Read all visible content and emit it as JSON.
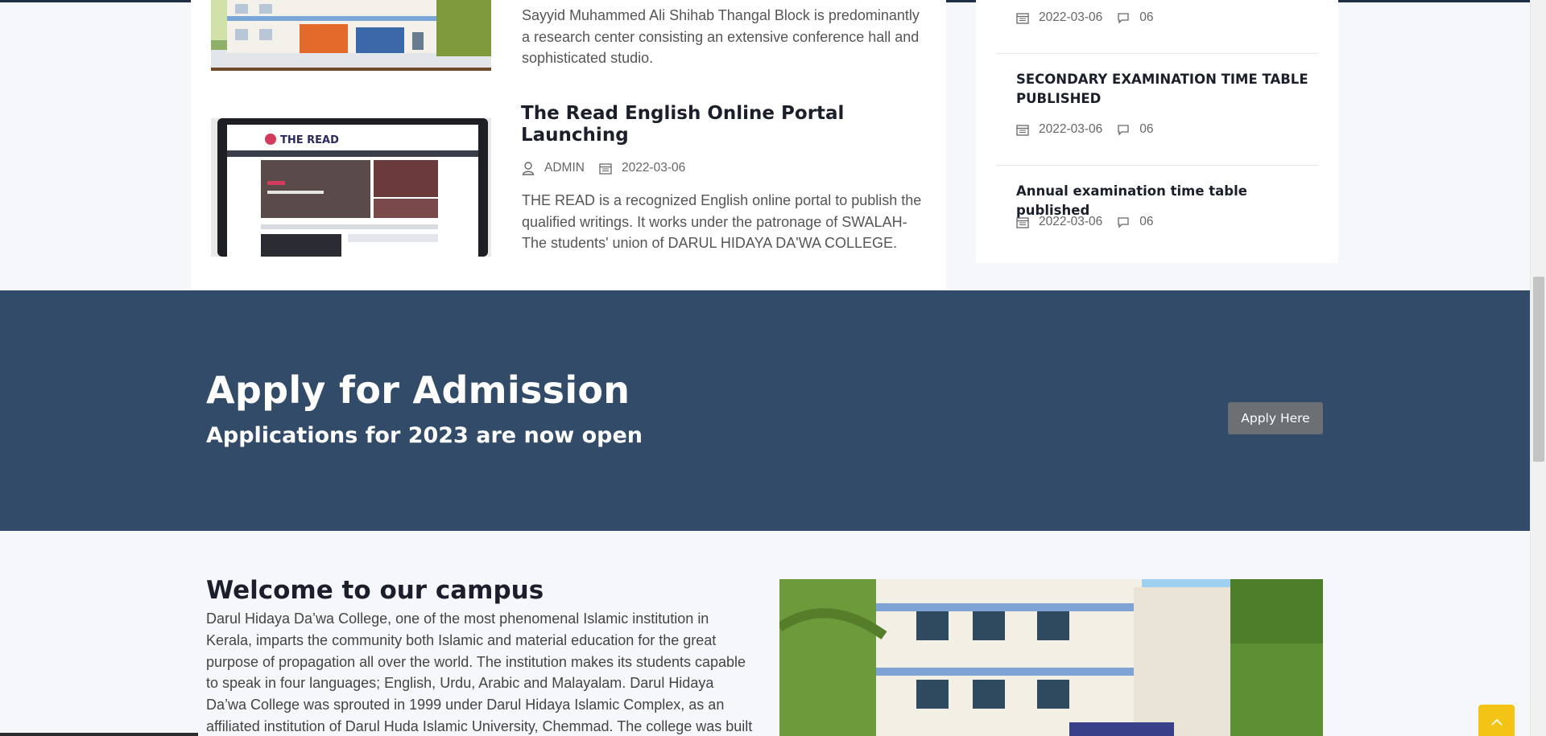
{
  "news": [
    {
      "excerpt": "Sayyid Muhammed Ali Shihab Thangal Block is predominantly a research center consisting an extensive conference hall and sophisticated studio."
    },
    {
      "title": "The Read English Online Portal Launching",
      "author": "ADMIN",
      "date": "2022-03-06",
      "excerpt": "THE READ is a recognized English online portal to publish the qualified writings. It works under the patronage of SWALAH- The students' union of DARUL HIDAYA DA'WA COLLEGE."
    }
  ],
  "sidebar": {
    "items": [
      {
        "title": "",
        "date": "2022-03-06",
        "comments": "06"
      },
      {
        "title": "SECONDARY EXAMINATION TIME TABLE PUBLISHED",
        "date": "2022-03-06",
        "comments": "06"
      },
      {
        "title": "Annual examination time table published",
        "date": "2022-03-06",
        "comments": "06"
      }
    ]
  },
  "admission": {
    "title": "Apply for Admission",
    "subtitle": "Applications for 2023 are now open",
    "button_label": "Apply Here"
  },
  "welcome": {
    "title": "Welcome to our campus",
    "text": "Darul Hidaya Da’wa College, one of the most phenomenal Islamic institution in Kerala, imparts the community both Islamic and material education for the great purpose of propagation all over the world. The institution makes its students capable to speak in four languages; English, Urdu, Arabic and Malayalam. Darul Hidaya Da’wa College was sprouted in 1999 under Darul Hidaya Islamic Complex, as an affiliated institution of Darul Huda Islamic University, Chemmad. The college was built as a result of long"
  },
  "portal_logo": {
    "text": "THE READ"
  },
  "colors": {
    "banner_bg": "#314b68",
    "button_bg": "#6b7075",
    "scroll_top_bg": "#f3c316",
    "heading": "#1a1f2b"
  },
  "icons": [
    "user-icon",
    "calendar-icon",
    "comment-icon",
    "chevron-up-icon"
  ]
}
